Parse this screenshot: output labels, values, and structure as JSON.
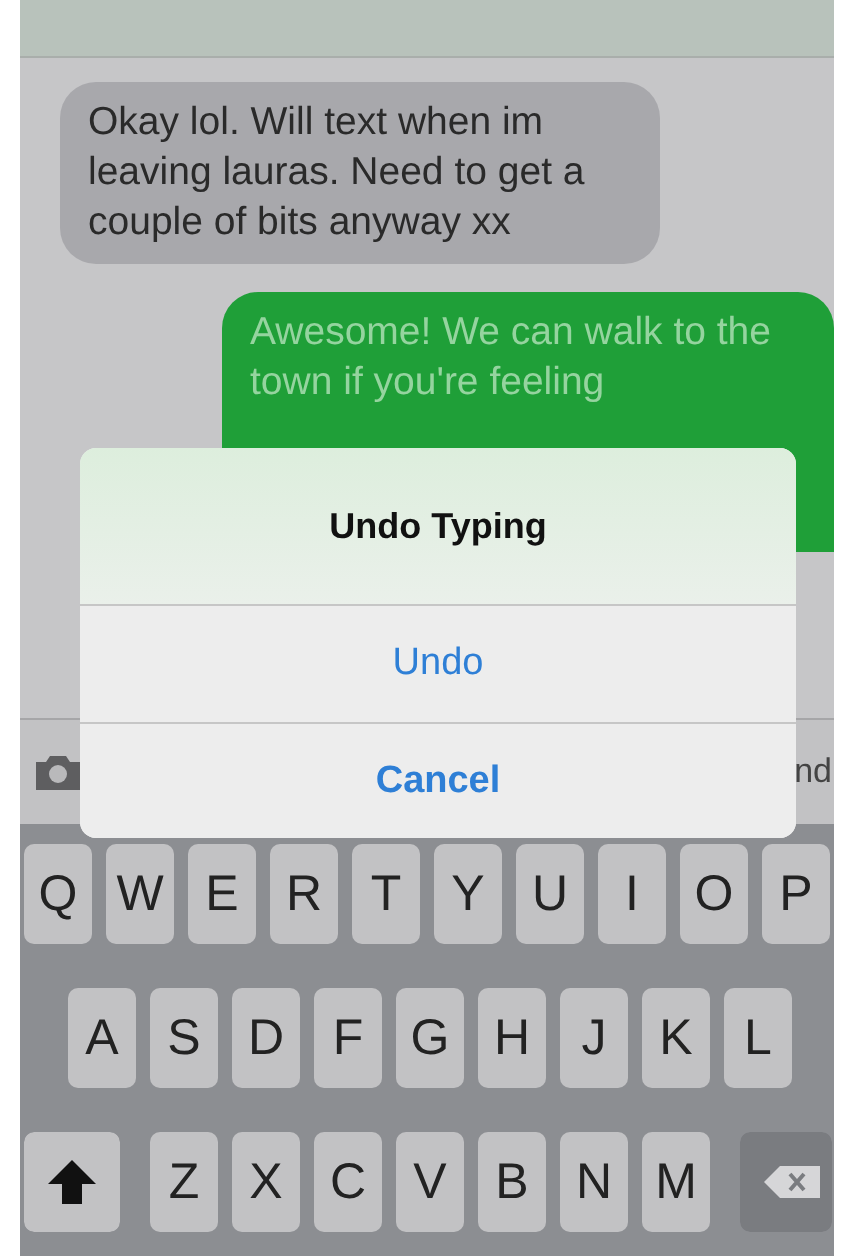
{
  "messages": [
    {
      "kind": "received",
      "text": "Okay lol. Will text when im leaving lauras. Need to get a couple of bits anyway xx"
    },
    {
      "kind": "sent",
      "text": "Awesome! We can walk to the town if you're feeling"
    }
  ],
  "input_bar": {
    "send_label": "nd"
  },
  "alert": {
    "title": "Undo Typing",
    "buttons": [
      {
        "label": "Undo",
        "bold": false
      },
      {
        "label": "Cancel",
        "bold": true
      }
    ]
  },
  "keyboard": {
    "rows": [
      [
        "Q",
        "W",
        "E",
        "R",
        "T",
        "Y",
        "U",
        "I",
        "O",
        "P"
      ],
      [
        "A",
        "S",
        "D",
        "F",
        "G",
        "H",
        "J",
        "K",
        "L"
      ],
      [
        "Z",
        "X",
        "C",
        "V",
        "B",
        "N",
        "M"
      ]
    ]
  }
}
